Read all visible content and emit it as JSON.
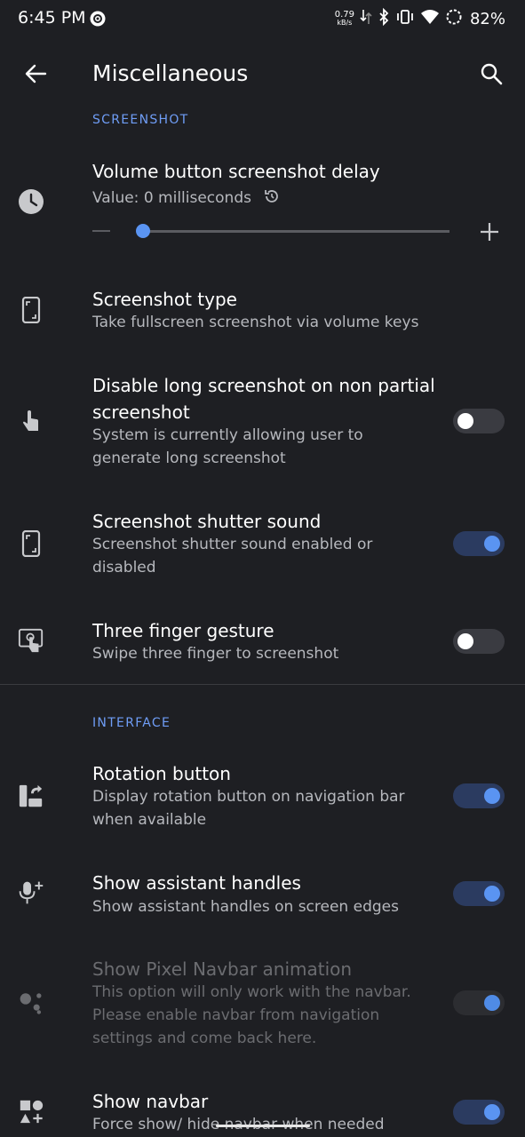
{
  "status_bar": {
    "time": "6:45 PM",
    "net_speed_value": "0.79",
    "net_speed_unit": "kB/s",
    "battery_percent": "82%",
    "icons": [
      "sync-circle-icon",
      "download-arrow-icon",
      "bluetooth-icon",
      "vibrate-icon",
      "wifi-icon",
      "battery-saver-ring-icon"
    ]
  },
  "app_bar": {
    "title": "Miscellaneous",
    "back_icon": "arrow-back-icon",
    "search_icon": "search-icon"
  },
  "sections": [
    {
      "header": "SCREENSHOT",
      "items": [
        {
          "icon": "clock-icon",
          "title": "Volume button screenshot delay",
          "subtitle": "Value: 0 milliseconds",
          "control": "slider",
          "slider_value_fraction": 0.0,
          "reset_icon": "reset-icon",
          "minus_icon": "minus-icon",
          "plus_icon": "plus-icon"
        },
        {
          "icon": "phone-screenshot-icon",
          "title": "Screenshot type",
          "subtitle": "Take fullscreen screenshot via volume keys",
          "control": "none"
        },
        {
          "icon": "touch-hand-icon",
          "title_line1": "Disable long screenshot on non partial",
          "title_line2": "screenshot",
          "subtitle_line1": "System is currently allowing user to",
          "subtitle_line2": "generate long screenshot",
          "control": "switch",
          "on": false
        },
        {
          "icon": "phone-screenshot-icon",
          "title": "Screenshot shutter sound",
          "subtitle_line1": "Screenshot shutter sound enabled or",
          "subtitle_line2": "disabled",
          "control": "switch",
          "on": true
        },
        {
          "icon": "three-finger-gesture-icon",
          "title": "Three finger gesture",
          "subtitle": "Swipe three finger to screenshot",
          "control": "switch",
          "on": false
        }
      ]
    },
    {
      "header": "INTERFACE",
      "items": [
        {
          "icon": "rotation-icon",
          "title": "Rotation button",
          "subtitle_line1": "Display rotation button on navigation bar",
          "subtitle_line2": "when available",
          "control": "switch",
          "on": true
        },
        {
          "icon": "mic-add-icon",
          "title": "Show assistant handles",
          "subtitle": "Show assistant handles on screen edges",
          "control": "switch",
          "on": true
        },
        {
          "icon": "assistant-dots-icon",
          "title": "Show Pixel Navbar animation",
          "subtitle_line1": "This option will only work with the navbar.",
          "subtitle_line2": "Please enable navbar from navigation",
          "subtitle_line3": "settings and come back here.",
          "control": "switch",
          "on": true,
          "enabled": false
        },
        {
          "icon": "shapes-icon",
          "title": "Show navbar",
          "subtitle": "Force show/ hide navbar when needed",
          "control": "switch",
          "on": true
        }
      ]
    }
  ],
  "colors": {
    "background": "#1e1f23",
    "accent": "#5a94f2",
    "section_header": "#6f9df6",
    "subtitle": "#b6b8bd"
  }
}
